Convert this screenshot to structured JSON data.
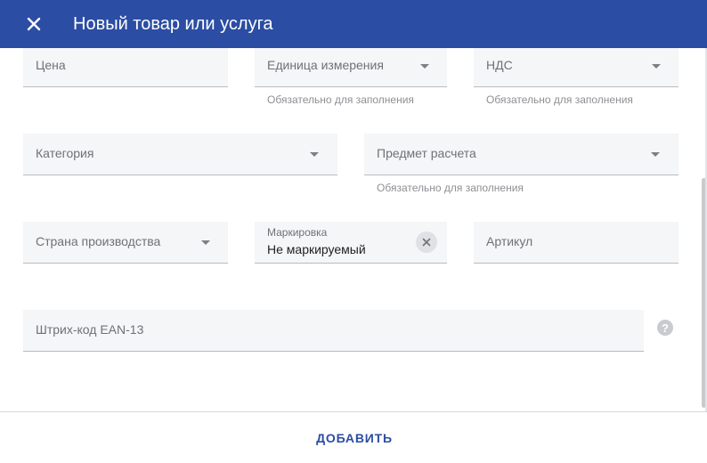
{
  "header": {
    "title": "Новый товар или услуга",
    "close_icon": "close-icon",
    "background": "#2b4da3"
  },
  "fields": {
    "price": {
      "label": "Цена"
    },
    "unit": {
      "label": "Единица измерения",
      "hint": "Обязательно для заполнения"
    },
    "vat": {
      "label": "НДС",
      "hint": "Обязательно для заполнения"
    },
    "category": {
      "label": "Категория"
    },
    "subject": {
      "label": "Предмет расчета",
      "hint": "Обязательно для заполнения"
    },
    "country": {
      "label": "Страна производства"
    },
    "marking": {
      "label": "Маркировка",
      "value": "Не маркируемый"
    },
    "article": {
      "label": "Артикул"
    },
    "barcode": {
      "label": "Штрих-код EAN-13",
      "help_icon": "help-icon"
    }
  },
  "footer": {
    "add_label": "ДОБАВИТЬ",
    "accent": "#2b4da3"
  }
}
